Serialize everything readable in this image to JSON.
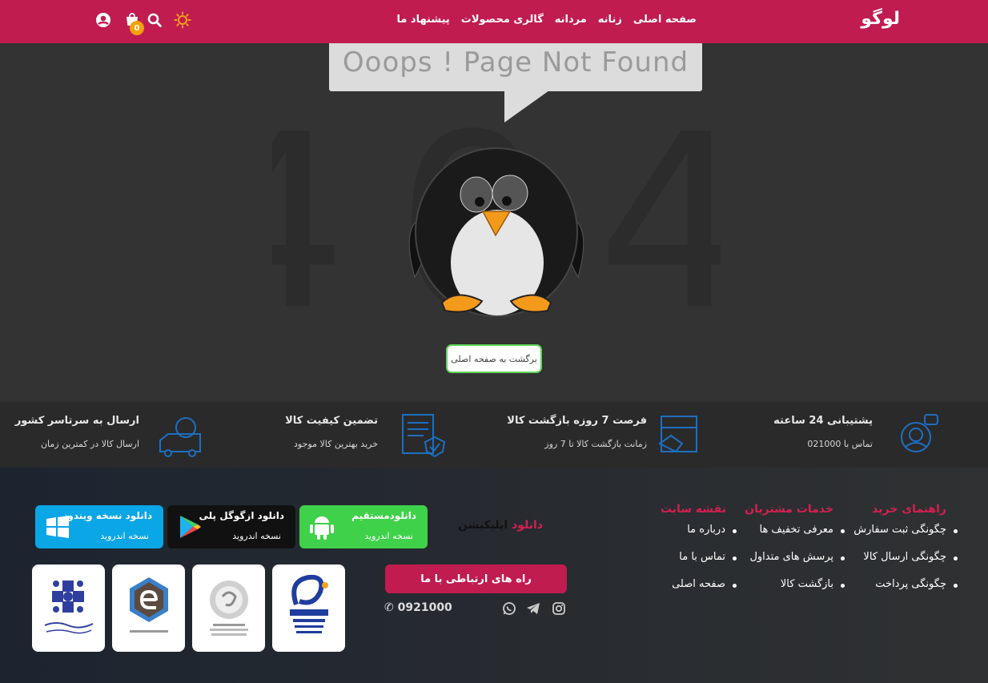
{
  "header": {
    "logo": "لوگو",
    "nav": [
      "صفحه اصلی",
      "زنانه",
      "مردانه",
      "گالری محصولات",
      "پیشنهاد ما"
    ],
    "cart_count": "0",
    "icons": [
      "user-icon",
      "cart-icon",
      "search-icon",
      "theme-sun-icon"
    ]
  },
  "error": {
    "message": "Ooops ! Page  Not Found",
    "code": "404",
    "home_button": "برگشت به صفحه اصلی"
  },
  "features": [
    {
      "title_pre": "پشتیبانی ",
      "title_bold": "24 ساعته",
      "sub": "تماس با 021000",
      "icon": "support-headset-icon"
    },
    {
      "title_pre": "فرصت 7 روزه ",
      "title_bold": "بازگشت کالا",
      "sub": "زمانت بازگشت کالا تا 7 روز",
      "icon": "return-box-icon"
    },
    {
      "title_pre": "تضمین ",
      "title_bold": "کیفیت کالا",
      "sub": "خرید بهترین کالا موجود",
      "icon": "quality-document-icon"
    },
    {
      "title_pre": "ارسال به ",
      "title_bold": "سرتاسر کشور",
      "sub": "ارسال کالا در کمترین زمان",
      "icon": "delivery-truck-icon"
    }
  ],
  "footer": {
    "columns": [
      {
        "title": "راهنمای خرید",
        "items": [
          "چگونگی ثبت سفارش",
          "چگونگی ارسال کالا",
          "چگونگی پرداخت"
        ]
      },
      {
        "title": "خدمات مشتریان",
        "items": [
          "معرفی تخفیف ها",
          "پرسش های متداول",
          "بازگشت کالا"
        ]
      },
      {
        "title": "نقشه سایت",
        "items": [
          "درباره ما",
          "تماس با ما",
          "صفحه اصلی"
        ]
      }
    ],
    "app_label_accent": "دانلود",
    "app_label_rest": " اپلیکیشن",
    "apps": [
      {
        "title_pre": "دانلود",
        "title_bold": "مستقیم",
        "sub": "نسخه اندروید",
        "color": "#3fd14a",
        "icon": "android-icon"
      },
      {
        "title_pre": "دانلود ",
        "title_bold": "ازگوگل پلی",
        "sub": "نسخه اندروید",
        "color": "#111111",
        "icon": "google-play-icon"
      },
      {
        "title_pre": "دانلود ",
        "title_bold": "نسخه ویندوز",
        "sub": "نسخه اندروید",
        "color": "#0aa6e6",
        "icon": "windows-icon"
      }
    ],
    "contact_button": "راه های ارتباطی با ما",
    "phone": "0921000",
    "social_icons": [
      "instagram-icon",
      "telegram-icon",
      "whatsapp-icon"
    ],
    "trust_badges": [
      "enamad-badge",
      "samandehi-badge",
      "e-commerce-association-badge",
      "business-union-badge"
    ]
  }
}
